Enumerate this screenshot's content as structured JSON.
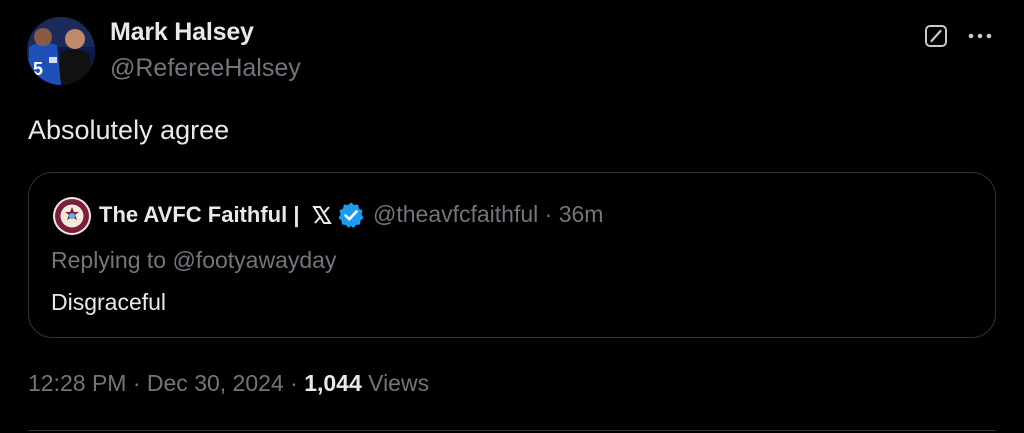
{
  "author": {
    "display_name": "Mark Halsey",
    "handle": "@RefereeHalsey"
  },
  "tweet": {
    "text": "Absolutely agree"
  },
  "quoted_tweet": {
    "display_name": "The AVFC Faithful | ",
    "handle_time": "@theavfcfaithful · 36m",
    "replying_to": "Replying to @footyawayday",
    "text": "Disgraceful"
  },
  "meta": {
    "time": "12:28 PM",
    "sep1": " · ",
    "date": "Dec 30, 2024",
    "sep2": " · ",
    "views_count": "1,044",
    "views_label": " Views"
  },
  "icons": {
    "grok": "grok-icon",
    "more": "more-icon",
    "verified": "verified-badge-icon",
    "x_logo": "x-logo-icon"
  },
  "colors": {
    "background": "#000000",
    "primary_text": "#e7e9ea",
    "secondary_text": "#71767b",
    "border": "#2f3336",
    "verified_blue": "#1d9bf0"
  }
}
